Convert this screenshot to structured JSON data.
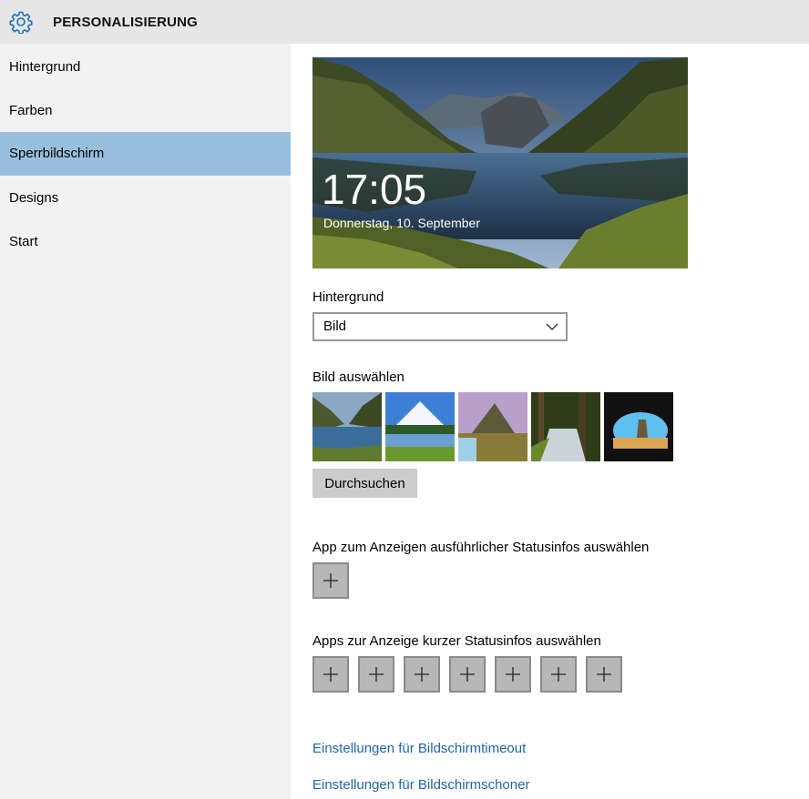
{
  "app": {
    "title": "PERSONALISIERUNG",
    "icon": "gear-icon"
  },
  "sidebar": {
    "items": [
      {
        "label": "Hintergrund",
        "active": false
      },
      {
        "label": "Farben",
        "active": false
      },
      {
        "label": "Sperrbildschirm",
        "active": true
      },
      {
        "label": "Designs",
        "active": false
      },
      {
        "label": "Start",
        "active": false
      }
    ]
  },
  "preview": {
    "time": "17:05",
    "date": "Donnerstag, 10. September"
  },
  "background": {
    "label": "Hintergrund",
    "selected": "Bild"
  },
  "picture": {
    "label": "Bild auswählen",
    "browse_label": "Durchsuchen",
    "thumbnails": [
      "fjord-lake",
      "snow-mountain-meadow",
      "pointed-mountain-waterfall",
      "forest-stream",
      "beach-cave"
    ]
  },
  "detailed_status": {
    "label": "App zum Anzeigen ausführlicher Statusinfos auswählen"
  },
  "quick_status": {
    "label": "Apps zur Anzeige kurzer Statusinfos auswählen"
  },
  "links": {
    "timeout": "Einstellungen für Bildschirmtimeout",
    "screensaver": "Einstellungen für Bildschirmschoner"
  },
  "colors": {
    "accent": "#99bfdc",
    "link": "#1f65a8",
    "gear": "#1f6fbf"
  }
}
